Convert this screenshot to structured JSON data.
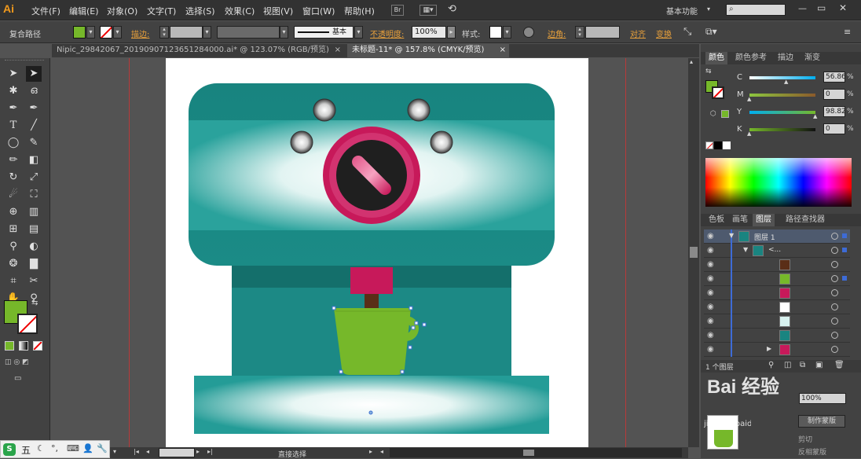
{
  "app": {
    "logo": "Ai"
  },
  "menu": [
    "文件(F)",
    "编辑(E)",
    "对象(O)",
    "文字(T)",
    "选择(S)",
    "效果(C)",
    "视图(V)",
    "窗口(W)",
    "帮助(H)"
  ],
  "workspace": {
    "label": "基本功能"
  },
  "window_controls": {
    "minimize": "—",
    "restore": "▭",
    "close": "✕"
  },
  "control_bar": {
    "selection_type": "复合路径",
    "stroke_label": "描边:",
    "stroke_profile": "基本",
    "opacity_label": "不透明度:",
    "opacity_value": "100%",
    "style_label": "样式:",
    "corner_label": "边角:",
    "align_label": "对齐",
    "transform_label": "变换"
  },
  "tabs": [
    {
      "label": "Nipic_29842067_20190907123651284000.ai* @ 123.07% (RGB/预览)",
      "close": "×"
    },
    {
      "label": "未标题-11* @ 157.8% (CMYK/预览)",
      "close": "×"
    }
  ],
  "tools": [
    "select-icon",
    "direct-select-icon",
    "magic-wand-icon",
    "lasso-icon",
    "pen-icon",
    "curvature-icon",
    "type-icon",
    "line-icon",
    "ellipse-icon",
    "paintbrush-icon",
    "pencil-icon",
    "eraser-icon",
    "rotate-icon",
    "scale-icon",
    "warp-icon",
    "free-transform-icon",
    "shape-builder-icon",
    "perspective-icon",
    "mesh-icon",
    "gradient-icon",
    "eyedropper-icon",
    "blend-icon",
    "symbol-sprayer-icon",
    "column-graph-icon",
    "artboard-icon",
    "slice-icon",
    "hand-icon",
    "zoom-icon"
  ],
  "colors": {
    "fill": "#76b82a",
    "teal_dark": "#1a8480",
    "teal_mid": "#27a39d",
    "magenta": "#c7195a",
    "cup_green": "#76b82a",
    "brown": "#5a2e17"
  },
  "color_panel": {
    "tabs": [
      "颜色",
      "颜色参考",
      "描边",
      "渐变"
    ],
    "channels": [
      {
        "label": "C",
        "value": "56.86",
        "fraction": 0.57
      },
      {
        "label": "M",
        "value": "0",
        "fraction": 0.0
      },
      {
        "label": "Y",
        "value": "98.82",
        "fraction": 0.99
      },
      {
        "label": "K",
        "value": "0",
        "fraction": 0.0
      }
    ],
    "unit": "%"
  },
  "layers_panel": {
    "tabs": [
      "色板",
      "画笔",
      "图层",
      "路径查找器"
    ],
    "rows": [
      {
        "name": "图层 1",
        "thumb": "#1a8480"
      },
      {
        "name": "<...",
        "thumb": "#1a8480"
      },
      {
        "name": "",
        "thumb": "#5a2e17"
      },
      {
        "name": "",
        "thumb": "#76b82a"
      },
      {
        "name": "",
        "thumb": "#c7195a"
      },
      {
        "name": "",
        "thumb": "#ffffff"
      },
      {
        "name": "",
        "thumb": "#d8f2ef"
      },
      {
        "name": "",
        "thumb": "#1a8480"
      },
      {
        "name": "",
        "thumb": "#c7195a"
      }
    ],
    "footer_count": "1 个图层"
  },
  "bottom_panel": {
    "make_mask": "制作蒙版",
    "opacity": "100%",
    "clip_label": "剪切",
    "invert_label": "反相蒙版"
  },
  "status": {
    "zoom": "",
    "mode": "直接选择"
  },
  "watermark": {
    "text": "Bai 经验",
    "sub": "jingyan.baidu.com"
  },
  "taskbar": {
    "ime": "五"
  }
}
